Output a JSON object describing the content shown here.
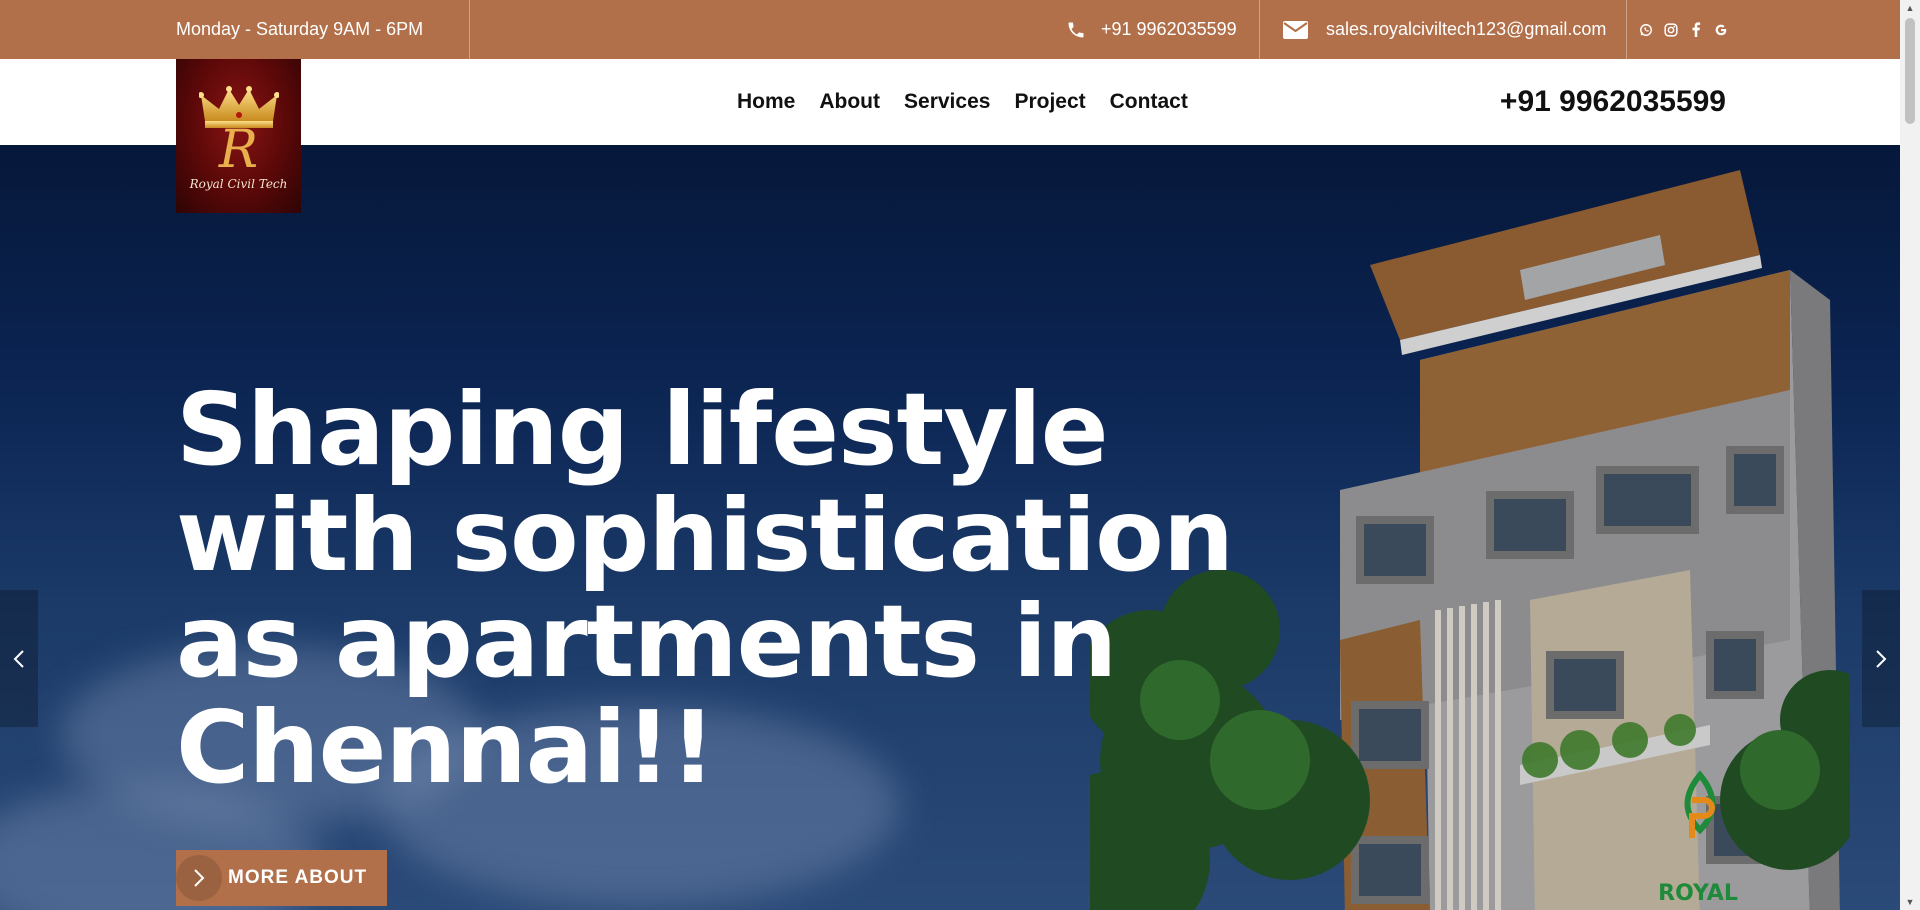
{
  "topbar": {
    "hours": "Monday - Saturday  9AM - 6PM",
    "phone": "+91 9962035599",
    "email": "sales.royalciviltech123@gmail.com",
    "social": [
      "whatsapp-icon",
      "instagram-icon",
      "facebook-icon",
      "google-icon"
    ]
  },
  "logo": {
    "monogram": "R",
    "wordmark": "Royal Civil Tech"
  },
  "nav": {
    "items": [
      "Home",
      "About",
      "Services",
      "Project",
      "Contact"
    ]
  },
  "header": {
    "phone": "+91 9962035599"
  },
  "hero": {
    "title": "Shaping lifestyle with sophistication as apartments in Chennai!!",
    "cta_label": "MORE ABOUT",
    "watermark": "ROYAL"
  },
  "colors": {
    "brand": "#b1704a",
    "hero_sky": "#0b2452"
  }
}
